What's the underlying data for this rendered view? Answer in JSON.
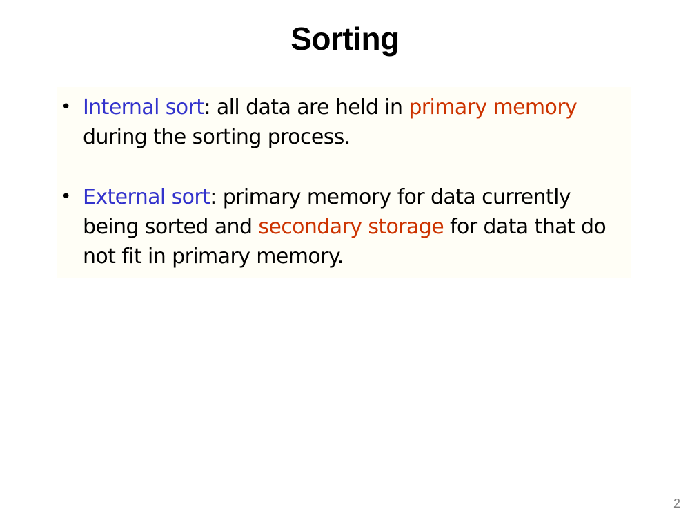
{
  "slide": {
    "title": "Sorting",
    "page_number": "2",
    "colors": {
      "term": "#3333cc",
      "highlight": "#cc3300",
      "text": "#000000",
      "box_background": "#fffef6"
    },
    "bullets": [
      {
        "term": "Internal sort",
        "colon": ":",
        "text_a": " all data are held in ",
        "highlight": "primary memory",
        "text_b": " during the sorting process."
      },
      {
        "term": "External sort",
        "colon": ":",
        "text_a": " primary memory for data currently being sorted and ",
        "highlight": "secondary storage",
        "text_b": " for data that do not fit in primary memory."
      }
    ]
  }
}
